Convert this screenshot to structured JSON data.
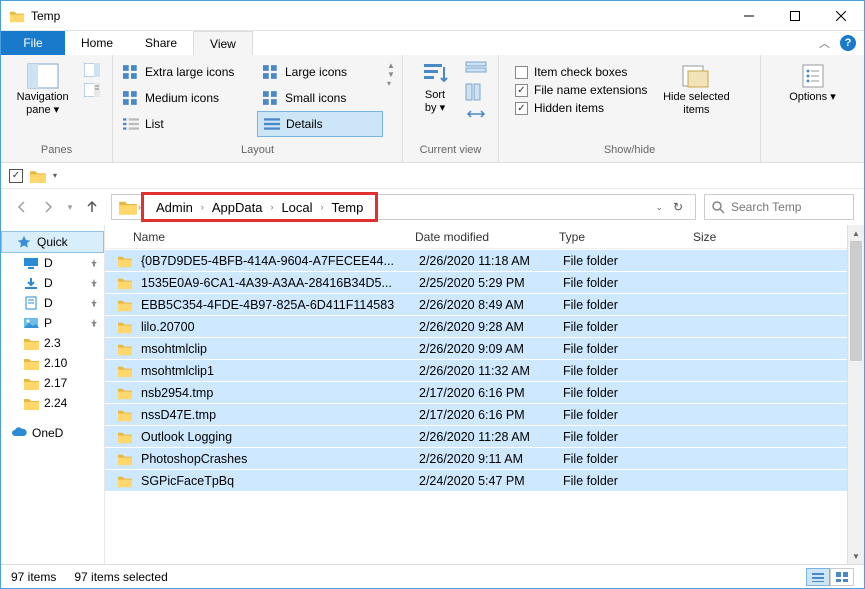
{
  "window": {
    "title": "Temp"
  },
  "tabs": {
    "file": "File",
    "home": "Home",
    "share": "Share",
    "view": "View"
  },
  "ribbon": {
    "panes": {
      "nav": "Navigation\npane",
      "group": "Panes"
    },
    "layout": {
      "xl": "Extra large icons",
      "lg": "Large icons",
      "md": "Medium icons",
      "sm": "Small icons",
      "list": "List",
      "details": "Details",
      "group": "Layout"
    },
    "currentview": {
      "sort": "Sort\nby",
      "group": "Current view"
    },
    "showhide": {
      "itemcheck": "Item check boxes",
      "ext": "File name extensions",
      "hidden": "Hidden items",
      "hide": "Hide selected\nitems",
      "group": "Show/hide"
    },
    "options": "Options"
  },
  "breadcrumb": [
    "Admin",
    "AppData",
    "Local",
    "Temp"
  ],
  "search": {
    "placeholder": "Search Temp"
  },
  "columns": {
    "name": "Name",
    "date": "Date modified",
    "type": "Type",
    "size": "Size"
  },
  "sidebar": {
    "quick": "Quick",
    "items": [
      {
        "label": "D",
        "icon": "desktop"
      },
      {
        "label": "D",
        "icon": "download"
      },
      {
        "label": "D",
        "icon": "document"
      },
      {
        "label": "P",
        "icon": "picture"
      },
      {
        "label": "2.3",
        "icon": "folder"
      },
      {
        "label": "2.10",
        "icon": "folder"
      },
      {
        "label": "2.17",
        "icon": "folder"
      },
      {
        "label": "2.24",
        "icon": "folder"
      }
    ],
    "onedrive": "OneD"
  },
  "files": [
    {
      "name": "{0B7D9DE5-4BFB-414A-9604-A7FECEE44...",
      "date": "2/26/2020 11:18 AM",
      "type": "File folder"
    },
    {
      "name": "1535E0A9-6CA1-4A39-A3AA-28416B34D5...",
      "date": "2/25/2020 5:29 PM",
      "type": "File folder"
    },
    {
      "name": "EBB5C354-4FDE-4B97-825A-6D411F114583",
      "date": "2/26/2020 8:49 AM",
      "type": "File folder"
    },
    {
      "name": "lilo.20700",
      "date": "2/26/2020 9:28 AM",
      "type": "File folder"
    },
    {
      "name": "msohtmlclip",
      "date": "2/26/2020 9:09 AM",
      "type": "File folder"
    },
    {
      "name": "msohtmlclip1",
      "date": "2/26/2020 11:32 AM",
      "type": "File folder"
    },
    {
      "name": "nsb2954.tmp",
      "date": "2/17/2020 6:16 PM",
      "type": "File folder"
    },
    {
      "name": "nssD47E.tmp",
      "date": "2/17/2020 6:16 PM",
      "type": "File folder"
    },
    {
      "name": "Outlook Logging",
      "date": "2/26/2020 11:28 AM",
      "type": "File folder"
    },
    {
      "name": "PhotoshopCrashes",
      "date": "2/26/2020 9:11 AM",
      "type": "File folder"
    },
    {
      "name": "SGPicFaceTpBq",
      "date": "2/24/2020 5:47 PM",
      "type": "File folder"
    }
  ],
  "status": {
    "count": "97 items",
    "selected": "97 items selected"
  }
}
